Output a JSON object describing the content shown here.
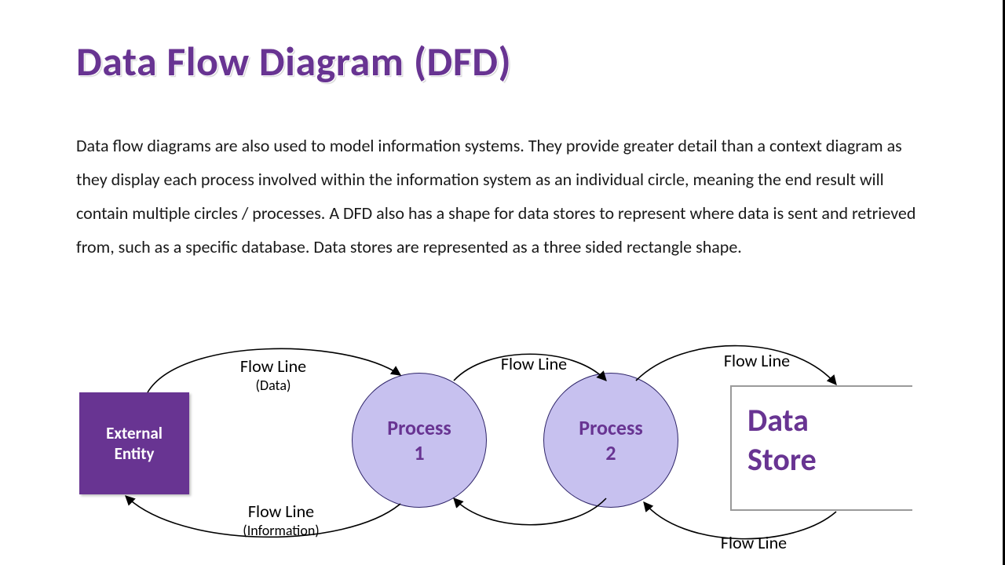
{
  "title": "Data Flow Diagram (DFD)",
  "paragraph": "Data flow diagrams are also used to model information systems. They provide greater detail than a context diagram as they display each process involved within the information system as an individual circle, meaning the end result will contain multiple circles / processes. A DFD also has a shape for data stores to represent where data is sent and retrieved from, such as a specific database. Data stores are represented as a three sided rectangle shape.",
  "nodes": {
    "external_entity": "External Entity",
    "process1": "Process 1",
    "process2": "Process 2",
    "data_store": "Data Store"
  },
  "flows": {
    "top_left_main": "Flow Line",
    "top_left_sub": "(Data)",
    "top_mid": "Flow Line",
    "top_right": "Flow Line",
    "bottom_left_main": "Flow Line",
    "bottom_left_sub": "(Information)",
    "bottom_right": "Flow Line"
  }
}
